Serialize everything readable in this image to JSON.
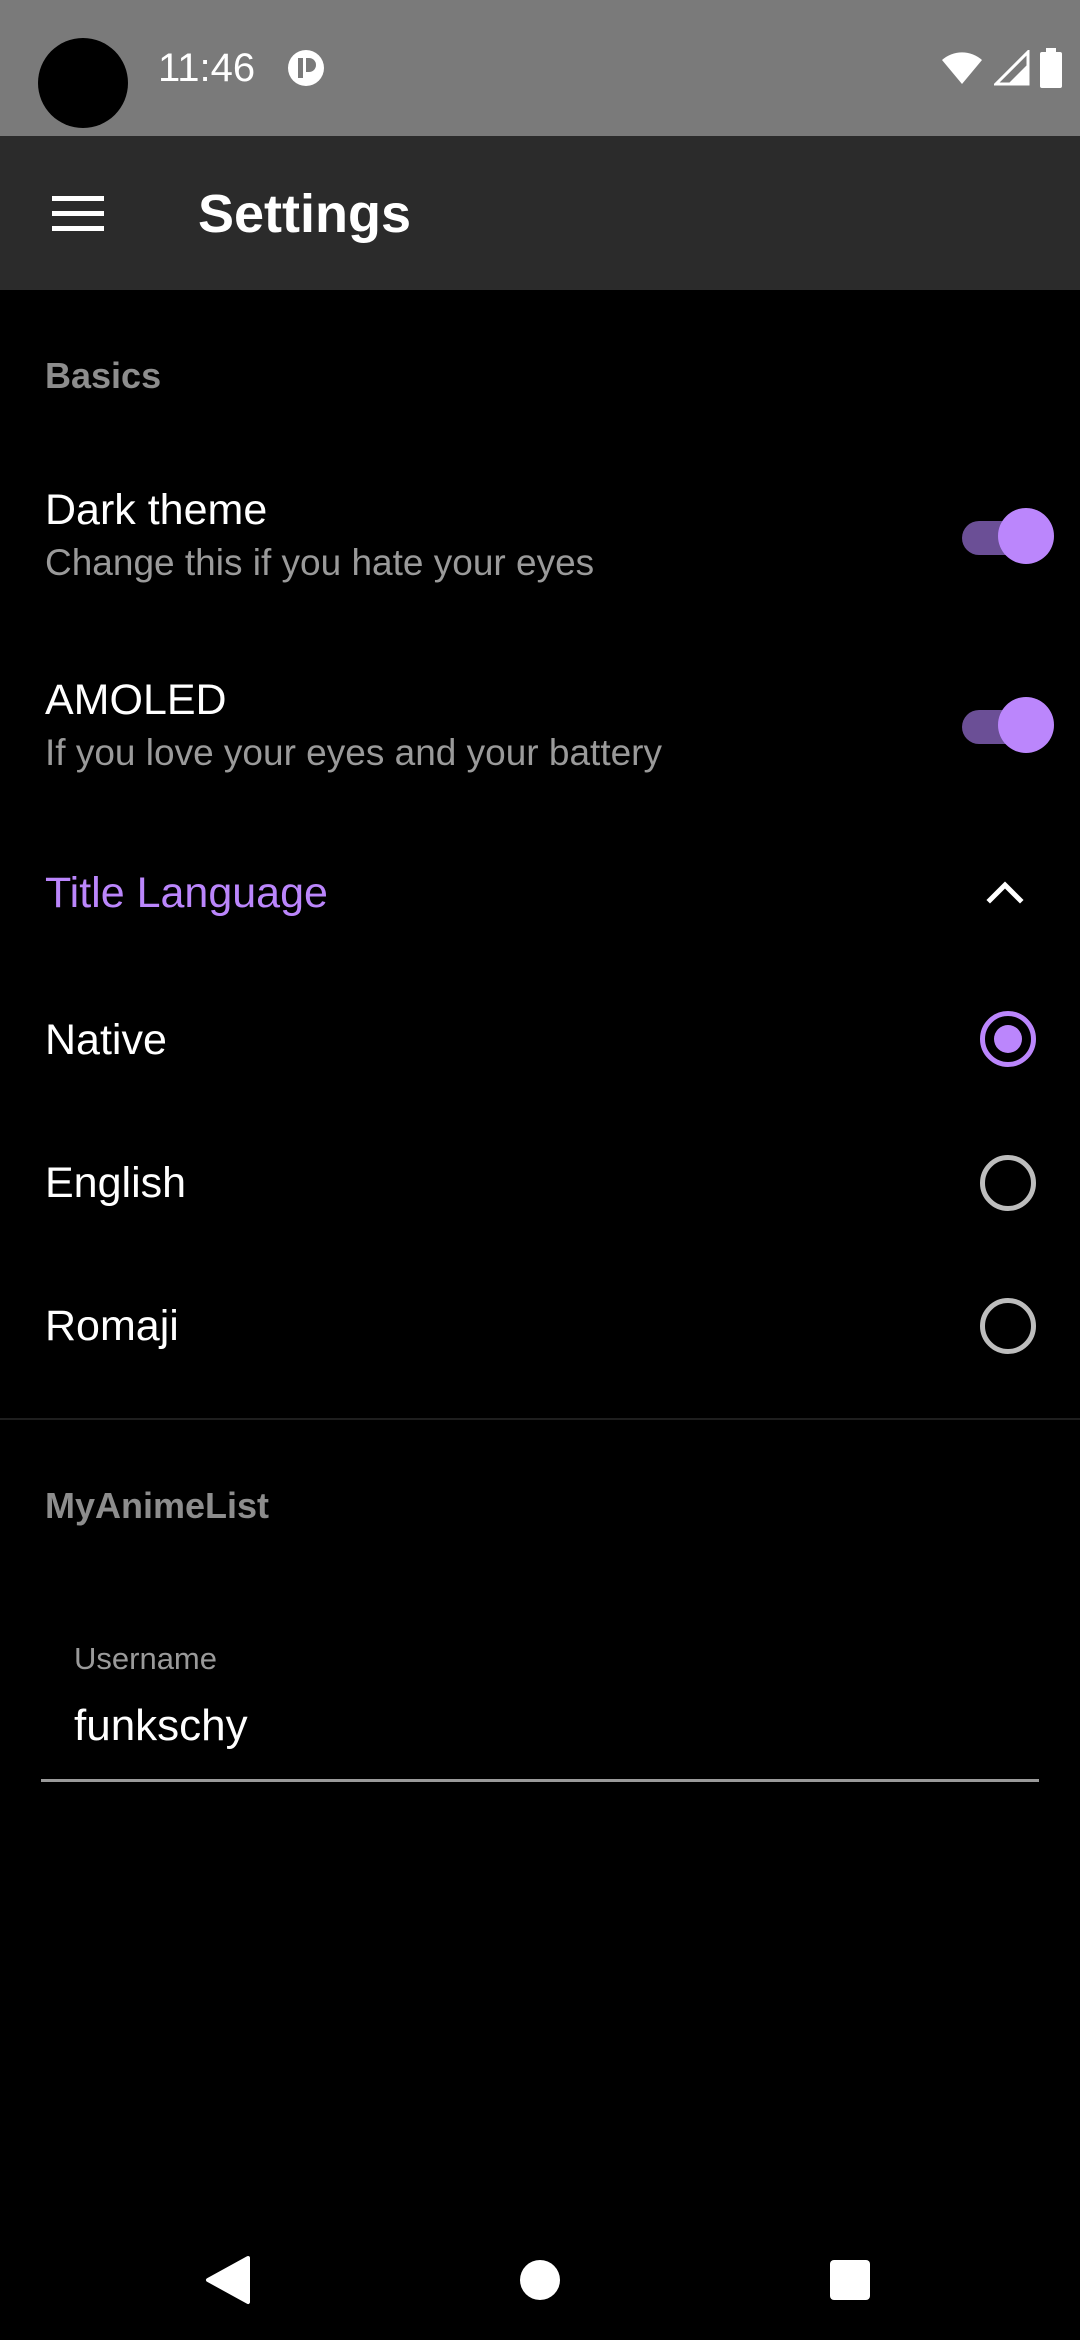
{
  "status_bar": {
    "time": "11:46",
    "icons": [
      "notification-icon",
      "wifi-icon",
      "signal-icon",
      "battery-icon"
    ]
  },
  "app_bar": {
    "menu_icon": "menu-icon",
    "title": "Settings"
  },
  "basics": {
    "header": "Basics",
    "dark_theme": {
      "title": "Dark theme",
      "summary": "Change this if you hate your eyes",
      "enabled": true
    },
    "amoled": {
      "title": "AMOLED",
      "summary": "If you love your eyes and your battery",
      "enabled": true
    }
  },
  "title_language": {
    "title": "Title Language",
    "expanded": true,
    "options": [
      {
        "label": "Native",
        "selected": true
      },
      {
        "label": "English",
        "selected": false
      },
      {
        "label": "Romaji",
        "selected": false
      }
    ]
  },
  "myanimelist": {
    "header": "MyAnimeList",
    "username_label": "Username",
    "username_value": "funkschy"
  },
  "colors": {
    "accent": "#bb86fc",
    "status_bar": "#7a7a7a",
    "app_bar": "#2b2b2b",
    "background": "#000000"
  },
  "nav_bar": {
    "buttons": [
      "back-icon",
      "home-icon",
      "recents-icon"
    ]
  }
}
